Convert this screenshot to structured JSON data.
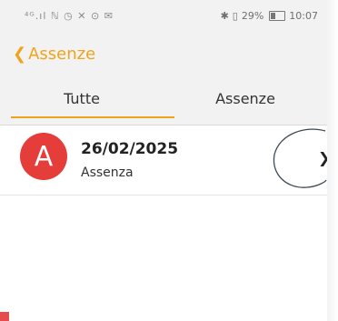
{
  "status_bar": {
    "left_icons": "⁴ᴳ.ıl ℕ ◷ ✕ ⊙ ✉",
    "bluetooth": "✱",
    "vibrate": "▯",
    "battery_percent": "29%",
    "time": "10:07"
  },
  "header": {
    "back_chevron": "❮",
    "back_label": "Assenze"
  },
  "tabs": [
    {
      "label": "Tutte",
      "active": true
    },
    {
      "label": "Assenze",
      "active": false
    }
  ],
  "list": {
    "items": [
      {
        "avatar_letter": "A",
        "date": "26/02/2025",
        "type": "Assenza",
        "chevron": "❯"
      }
    ]
  },
  "colors": {
    "accent": "#f0a41c",
    "avatar": "#e53e3a",
    "background": "#f2f2f2"
  }
}
